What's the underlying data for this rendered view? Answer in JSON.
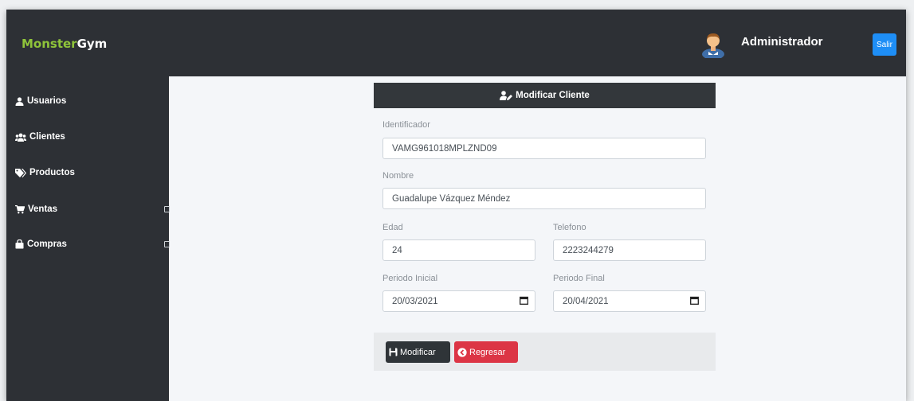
{
  "brand": {
    "part1": "Monster",
    "part2": "Gym",
    "primary_color": "#8fc43a"
  },
  "header": {
    "user_name": "Administrador",
    "logout_label": "Salir",
    "avatar_icon": "user-avatar-icon"
  },
  "sidebar": {
    "items": [
      {
        "label": "Usuarios",
        "icon": "user-icon"
      },
      {
        "label": "Clientes",
        "icon": "users-icon"
      },
      {
        "label": "Productos",
        "icon": "tags-icon"
      },
      {
        "label": "Ventas",
        "icon": "cart-icon",
        "has_submenu": true
      },
      {
        "label": "Compras",
        "icon": "bag-icon",
        "has_submenu": true
      }
    ]
  },
  "form": {
    "title": "Modificar Cliente",
    "title_icon": "user-edit-icon",
    "fields": {
      "id": {
        "label": "Identificador",
        "value": "VAMG961018MPLZND09"
      },
      "name": {
        "label": "Nombre",
        "value": "Guadalupe Vázquez Méndez"
      },
      "age": {
        "label": "Edad",
        "value": "24"
      },
      "phone": {
        "label": "Telefono",
        "value": "2223244279"
      },
      "start": {
        "label": "Periodo Inicial",
        "value": "20/03/2021"
      },
      "end": {
        "label": "Periodo Final",
        "value": "20/04/2021"
      }
    },
    "buttons": {
      "save": "Modificar",
      "back": "Regresar"
    }
  },
  "colors": {
    "topbar": "#2d3035",
    "accent_blue": "#1e8ef6",
    "danger": "#dc3545"
  }
}
